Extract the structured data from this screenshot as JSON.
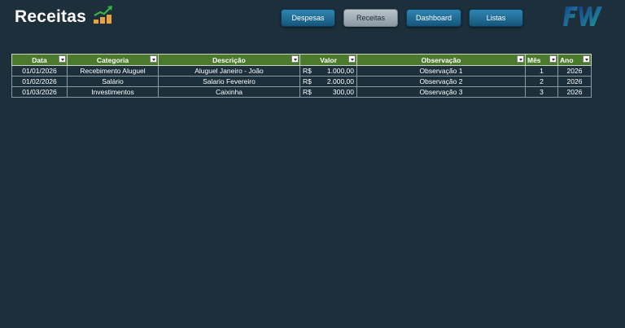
{
  "page": {
    "title": "Receitas"
  },
  "nav": {
    "despesas": "Despesas",
    "receitas": "Receitas",
    "dashboard": "Dashboard",
    "listas": "Listas"
  },
  "colors": {
    "background": "#1c2f3b",
    "table_header": "#4c7a2c",
    "button": "#1f6f98",
    "button_active": "#a3afb7"
  },
  "table": {
    "headers": [
      "Data",
      "Categoria",
      "Descrição",
      "Valor",
      "Observação",
      "Mês",
      "Ano"
    ],
    "rows": [
      {
        "data": "01/01/2026",
        "categoria": "Recebimento Aluguel",
        "descricao": "Aluguel Janeiro - João",
        "moeda": "R$",
        "valor": "1.000,00",
        "observacao": "Observação 1",
        "mes": "1",
        "ano": "2026"
      },
      {
        "data": "01/02/2026",
        "categoria": "Salário",
        "descricao": "Salario Fevereiro",
        "moeda": "R$",
        "valor": "2.000,00",
        "observacao": "Observação 2",
        "mes": "2",
        "ano": "2026"
      },
      {
        "data": "01/03/2026",
        "categoria": "Investimentos",
        "descricao": "Caixinha",
        "moeda": "R$",
        "valor": "300,00",
        "observacao": "Observação 3",
        "mes": "3",
        "ano": "2026"
      }
    ]
  }
}
